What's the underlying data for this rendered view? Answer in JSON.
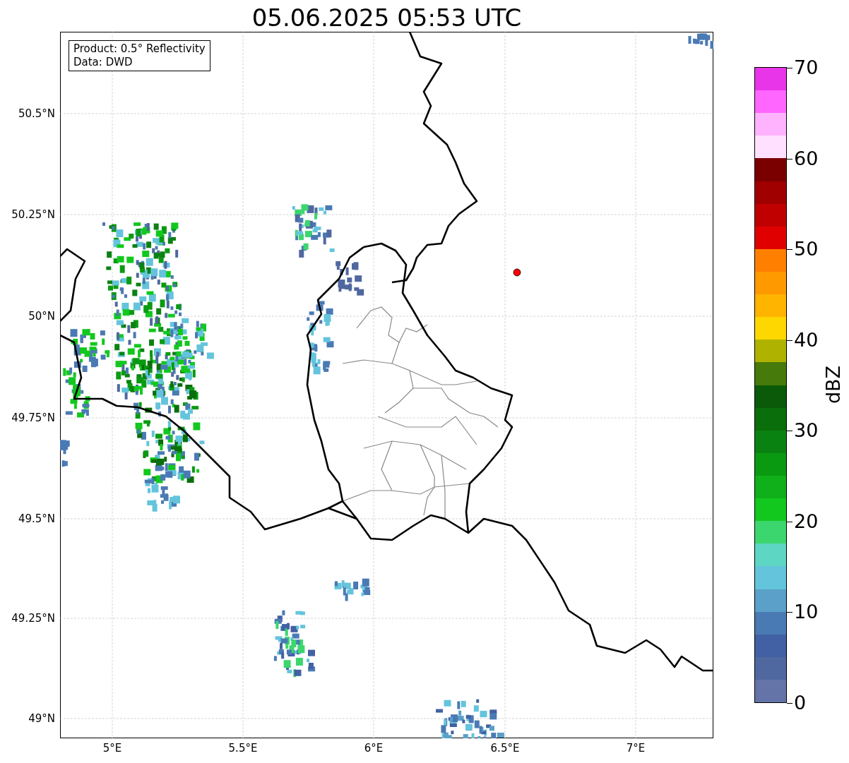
{
  "title": "05.06.2025 05:53 UTC",
  "info_box": [
    "Product: 0.5° Reflectivity",
    "Data: DWD"
  ],
  "map": {
    "y_ticks": [
      "50.5°N",
      "50.25°N",
      "50°N",
      "49.75°N",
      "49.5°N",
      "49.25°N",
      "49°N"
    ],
    "x_ticks": [
      "5°E",
      "5.5°E",
      "6°E",
      "6.5°E",
      "7°E"
    ]
  },
  "colorbar": {
    "label": "dBZ",
    "ticks": [
      "70",
      "60",
      "50",
      "40",
      "30",
      "20",
      "10",
      "0"
    ],
    "bins": [
      {
        "color": "#e935ea"
      },
      {
        "color": "#ff66ff"
      },
      {
        "color": "#ffb3ff"
      },
      {
        "color": "#ffe0ff"
      },
      {
        "color": "#7a0000"
      },
      {
        "color": "#a00000"
      },
      {
        "color": "#c00000"
      },
      {
        "color": "#e00000"
      },
      {
        "color": "#ff7f00"
      },
      {
        "color": "#ff9900"
      },
      {
        "color": "#ffb400"
      },
      {
        "color": "#ffd700"
      },
      {
        "color": "#afb300"
      },
      {
        "color": "#467a0a"
      },
      {
        "color": "#0a5a0a"
      },
      {
        "color": "#0a6e0a"
      },
      {
        "color": "#0a8212"
      },
      {
        "color": "#0a9a12"
      },
      {
        "color": "#10b01a"
      },
      {
        "color": "#12c81e"
      },
      {
        "color": "#3cd66e"
      },
      {
        "color": "#5ed6c4"
      },
      {
        "color": "#64c4dc"
      },
      {
        "color": "#5aa0c8"
      },
      {
        "color": "#4a7ab4"
      },
      {
        "color": "#4260a4"
      },
      {
        "color": "#5068a0"
      },
      {
        "color": "#6474a8"
      }
    ]
  }
}
